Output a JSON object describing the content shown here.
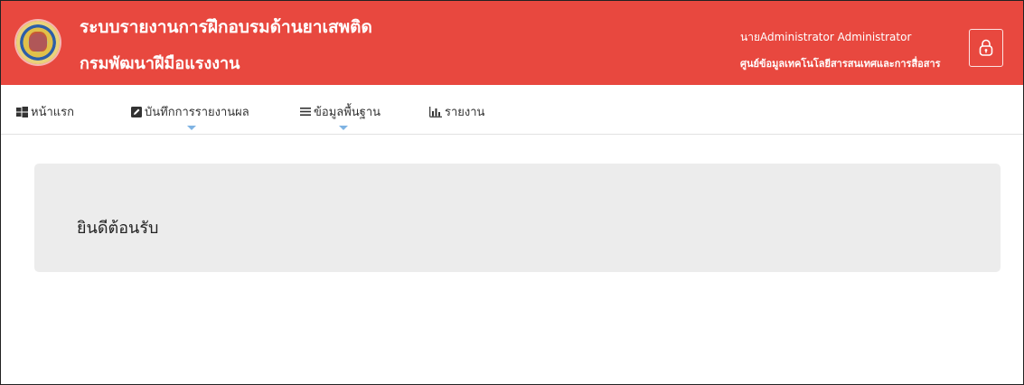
{
  "header": {
    "title_line1": "ระบบรายงานการฝึกอบรมด้านยาเสพติด",
    "title_line2": "กรมพัฒนาฝีมือแรงงาน",
    "user_name": "นายAdministrator Administrator",
    "user_department": "ศูนย์ข้อมูลเทคโนโลยีสารสนเทศและการสื่อสาร",
    "logout_icon": "lock-icon",
    "background_color": "#e8483f"
  },
  "nav": {
    "items": [
      {
        "label": "หน้าแรก",
        "icon": "windows-grid-icon",
        "has_dropdown": false
      },
      {
        "label": "บันทึกการรายงานผล",
        "icon": "edit-icon",
        "has_dropdown": true
      },
      {
        "label": "ข้อมูลพื้นฐาน",
        "icon": "list-icon",
        "has_dropdown": true
      },
      {
        "label": "รายงาน",
        "icon": "bar-chart-icon",
        "has_dropdown": false
      }
    ],
    "dropdown_caret_color": "#7fb3e3"
  },
  "main": {
    "welcome_text": "ยินดีต้อนรับ",
    "panel_color": "#ececec"
  }
}
